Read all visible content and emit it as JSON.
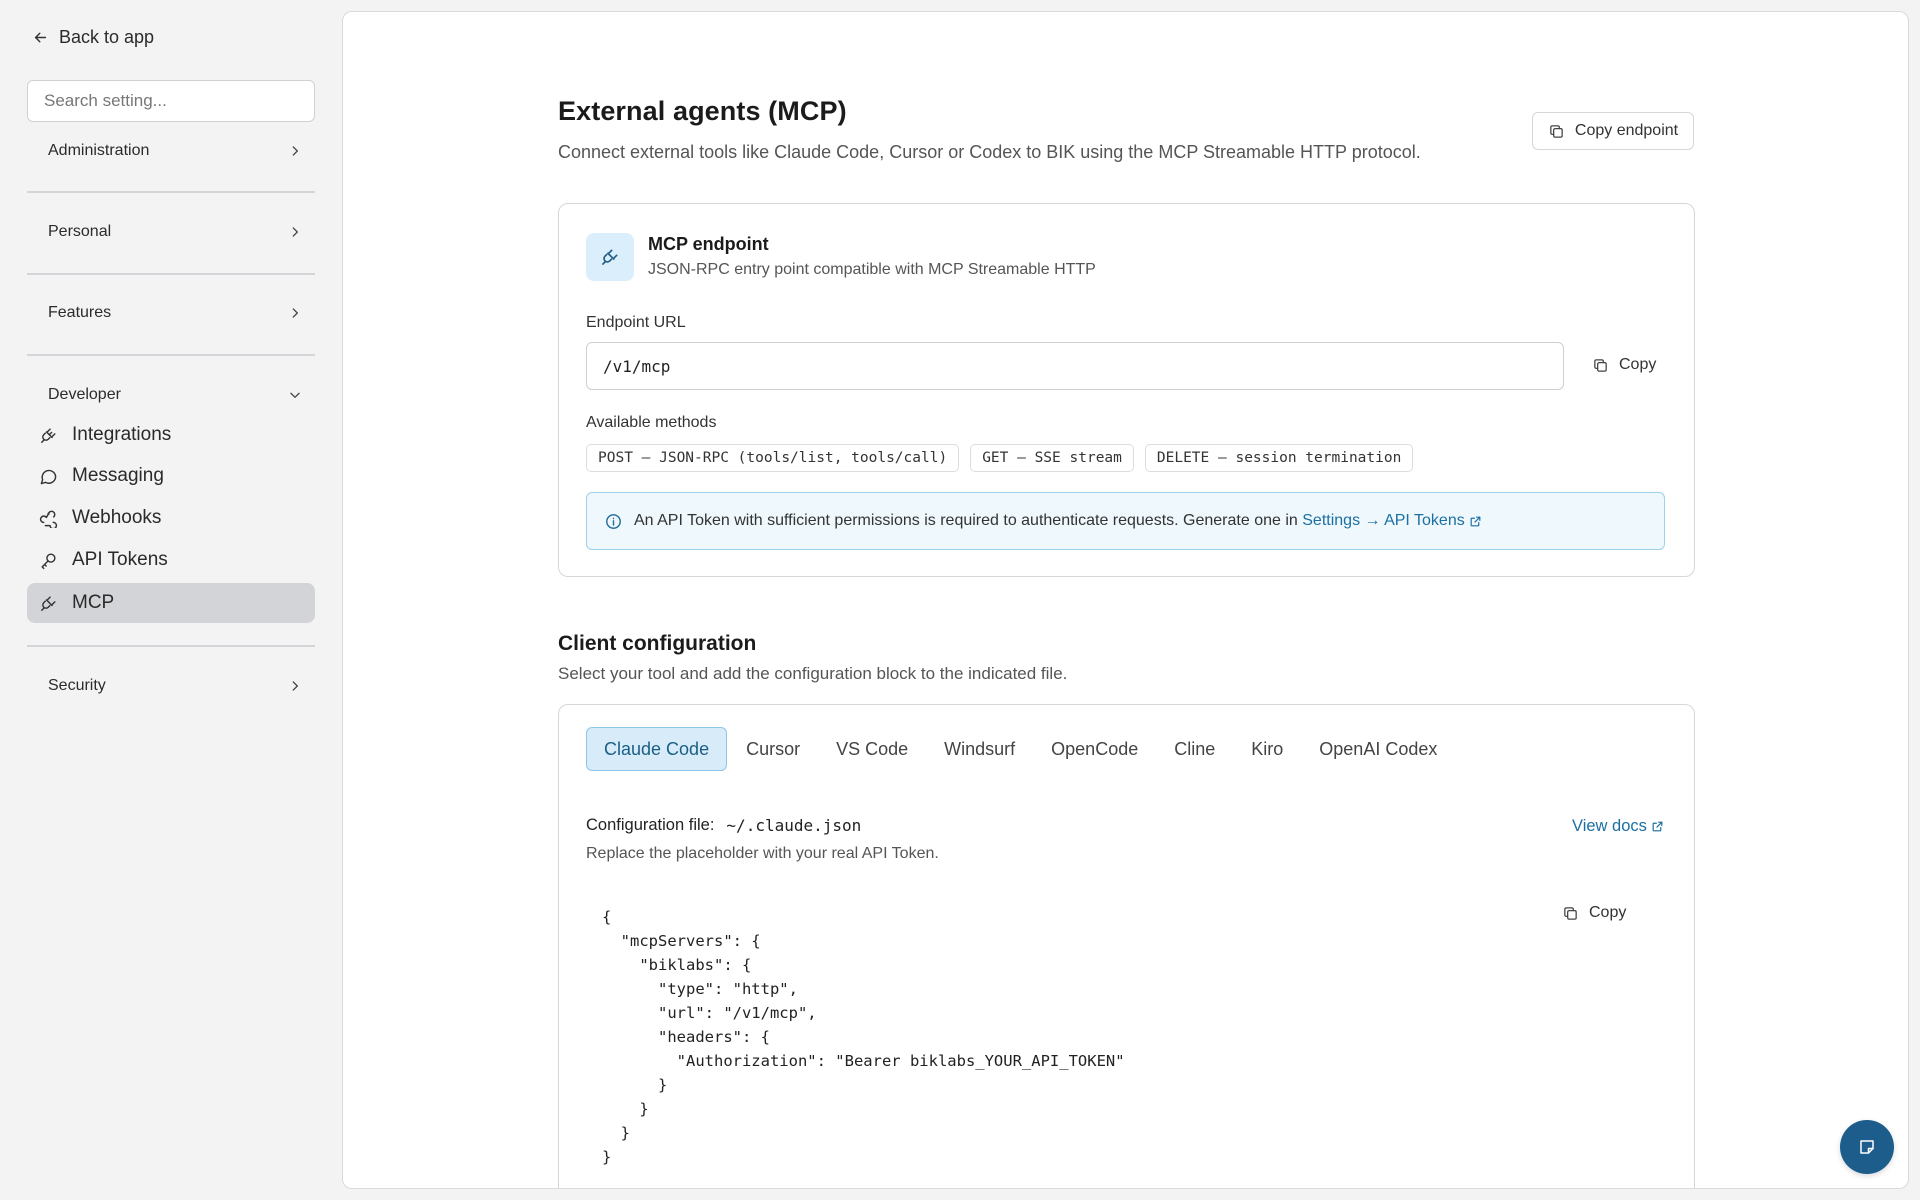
{
  "sidebar": {
    "back_label": "Back to app",
    "search_placeholder": "Search setting...",
    "sections": {
      "administration": "Administration",
      "personal": "Personal",
      "features": "Features",
      "developer": "Developer",
      "security": "Security"
    },
    "developer_items": [
      {
        "label": "Integrations",
        "icon": "plug-icon"
      },
      {
        "label": "Messaging",
        "icon": "chat-bubble-icon"
      },
      {
        "label": "Webhooks",
        "icon": "webhook-icon"
      },
      {
        "label": "API Tokens",
        "icon": "key-icon"
      },
      {
        "label": "MCP",
        "icon": "plug-icon",
        "active": true
      }
    ]
  },
  "header": {
    "title": "External agents (MCP)",
    "subtitle": "Connect external tools like Claude Code, Cursor or Codex to BIK using the MCP Streamable HTTP protocol.",
    "copy_endpoint_label": "Copy endpoint"
  },
  "endpoint_card": {
    "title": "MCP endpoint",
    "description": "JSON-RPC entry point compatible with MCP Streamable HTTP",
    "url_label": "Endpoint URL",
    "url_value": "/v1/mcp",
    "copy_label": "Copy",
    "methods_label": "Available methods",
    "methods": [
      "POST — JSON-RPC (tools/list, tools/call)",
      "GET — SSE stream",
      "DELETE — session termination"
    ],
    "info_text": "An API Token with sufficient permissions is required to authenticate requests. Generate one in",
    "info_link": "Settings → API Tokens"
  },
  "client_config": {
    "title": "Client configuration",
    "subtitle": "Select your tool and add the configuration block to the indicated file.",
    "tabs": [
      "Claude Code",
      "Cursor",
      "VS Code",
      "Windsurf",
      "OpenCode",
      "Cline",
      "Kiro",
      "OpenAI Codex"
    ],
    "active_tab": "Claude Code",
    "file_label": "Configuration file:",
    "file_path": "~/.claude.json",
    "view_docs_label": "View docs",
    "note": "Replace the placeholder with your real API Token.",
    "copy_label": "Copy",
    "code": "{\n  \"mcpServers\": {\n    \"biklabs\": {\n      \"type\": \"http\",\n      \"url\": \"/v1/mcp\",\n      \"headers\": {\n        \"Authorization\": \"Bearer biklabs_YOUR_API_TOKEN\"\n      }\n    }\n  }\n}"
  },
  "colors": {
    "accent": "#1c6fa2",
    "fab": "#1c5d8c",
    "active_tab_bg": "#d7ebf8",
    "info_bg": "#eef8fd",
    "sidebar_active_bg": "#d3d4d7"
  }
}
